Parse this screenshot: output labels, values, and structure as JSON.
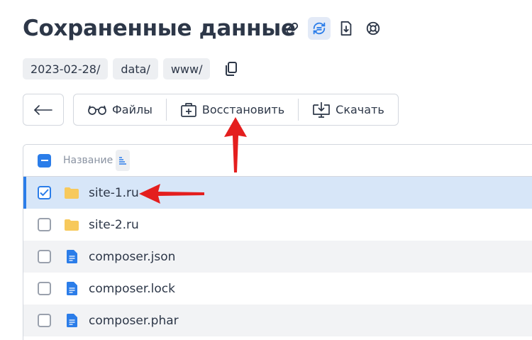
{
  "page_title": "Сохраненные данные",
  "title_icons": [
    "link-icon",
    "sync-icon",
    "download-file-icon",
    "lifebuoy-icon"
  ],
  "breadcrumbs": [
    "2023-02-28/",
    "data/",
    "www/"
  ],
  "toolbar": {
    "files_label": "Файлы",
    "restore_label": "Восстановить",
    "download_label": "Скачать"
  },
  "table": {
    "name_header": "Название",
    "rows": [
      {
        "name": "site-1.ru",
        "type": "folder",
        "checked": true
      },
      {
        "name": "site-2.ru",
        "type": "folder",
        "checked": false
      },
      {
        "name": "composer.json",
        "type": "file",
        "checked": false
      },
      {
        "name": "composer.lock",
        "type": "file",
        "checked": false
      },
      {
        "name": "composer.phar",
        "type": "file",
        "checked": false
      }
    ]
  },
  "colors": {
    "accent": "#2b7de9",
    "selected_row": "#d7e6f8",
    "folder": "#f7c95c",
    "annotation_arrow": "#e41e1e"
  }
}
